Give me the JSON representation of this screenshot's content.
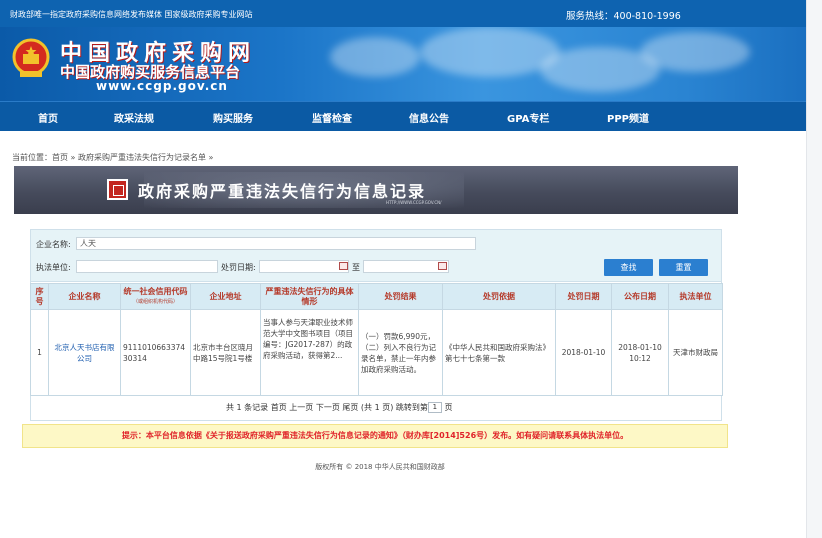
{
  "topbar": {
    "left_text": "财政部唯一指定政府采购信息网络发布媒体 国家级政府采购专业网站",
    "hotline": "服务热线：400-810-1996"
  },
  "banner": {
    "title": "中国政府采购网",
    "subtitle": "中国政府购买服务信息平台",
    "url": "www.ccgp.gov.cn",
    "emblem_icon": "national-emblem-icon"
  },
  "nav": {
    "items": [
      "首页",
      "政采法规",
      "购买服务",
      "监督检查",
      "信息公告",
      "GPA专栏",
      "PPP频道"
    ]
  },
  "breadcrumb": "当前位置：首页 » 政府采购严重违法失信行为记录名单 »",
  "title_bar": {
    "title": "政府采购严重违法失信行为信息记录",
    "sub": "HTTP://WWW.CCGP.GOV.CN/"
  },
  "search": {
    "company_label": "企业名称:",
    "company_value": "人天",
    "unit_label": "执法单位:",
    "date_label": "处罚日期:",
    "to_label": "至",
    "search_button": "查找",
    "reset_button": "重置"
  },
  "table": {
    "headers": [
      {
        "label": "序号",
        "sub": ""
      },
      {
        "label": "企业名称",
        "sub": ""
      },
      {
        "label": "统一社会信用代码",
        "sub": "（或组织机构代码）"
      },
      {
        "label": "企业地址",
        "sub": ""
      },
      {
        "label": "严重违法失信行为的具体情形",
        "sub": ""
      },
      {
        "label": "处罚结果",
        "sub": ""
      },
      {
        "label": "处罚依据",
        "sub": ""
      },
      {
        "label": "处罚日期",
        "sub": ""
      },
      {
        "label": "公布日期",
        "sub": ""
      },
      {
        "label": "执法单位",
        "sub": ""
      }
    ],
    "rows": [
      {
        "index": "1",
        "company": "北京人天书店有限公司",
        "credit_code": "911101066337430314",
        "address": "北京市丰台区晓月中路15号院1号楼",
        "situation": "当事人参与天津职业技术师范大学中文图书项目（项目编号：JG2017-287）的政府采购活动，获得第2...",
        "result": "（一）罚款6,990元，（二）列入不良行为记录名单，禁止一年内参加政府采购活动。",
        "basis": "《中华人民共和国政府采购法》第七十七条第一款",
        "penalty_date": "2018-01-10",
        "publish_date": "2018-01-10 10:12",
        "unit": "天津市财政局"
      }
    ]
  },
  "pager": {
    "summary": "共 1 条记录",
    "first": "首页",
    "prev": "上一页",
    "next": "下一页",
    "last": "尾页",
    "pages": "(共 1 页)",
    "jump": "跳转到第",
    "page_value": "1",
    "page_suffix": "页"
  },
  "notice": "提示：本平台信息依据《关于报送政府采购严重违法失信行为信息记录的通知》（财办库[2014]526号）发布。如有疑问请联系具体执法单位。",
  "footer": "版权所有 © 2018 中华人民共和国财政部",
  "colors": {
    "brand_blue": "#0e63b0",
    "nav_blue": "#0b5aa4",
    "header_red": "#b53a2a",
    "notice_red": "#e0242a"
  }
}
